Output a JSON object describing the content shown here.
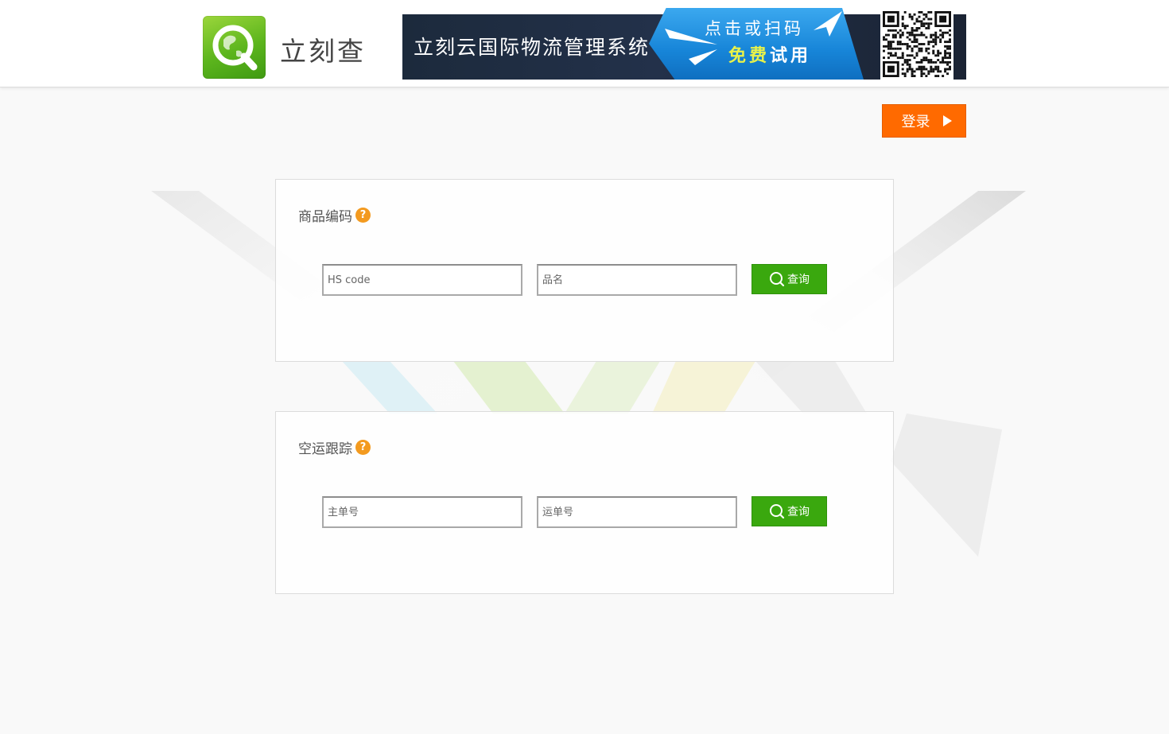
{
  "header": {
    "logo_text": "立刻查",
    "banner": {
      "title": "立刻云国际物流管理系统",
      "line1": "点击或扫码",
      "free": "免费",
      "trial": "试用"
    }
  },
  "login": {
    "label": "登录"
  },
  "panels": [
    {
      "title": "商品编码",
      "help": "?",
      "field1_placeholder": "HS code",
      "field2_placeholder": "品名",
      "button_label": "查询"
    },
    {
      "title": "空运跟踪",
      "help": "?",
      "field1_placeholder": "主单号",
      "field2_placeholder": "运单号",
      "button_label": "查询"
    }
  ],
  "colors": {
    "login": "#ff6a00",
    "query": "#3aa80e",
    "help": "#f39a1f",
    "logo": "#5cb51d"
  },
  "icons": {
    "logo": "magnifier-globe-icon",
    "help": "question-icon",
    "search": "search-icon",
    "login_arrow": "play-arrow-icon",
    "qr": "qr-code-icon"
  }
}
